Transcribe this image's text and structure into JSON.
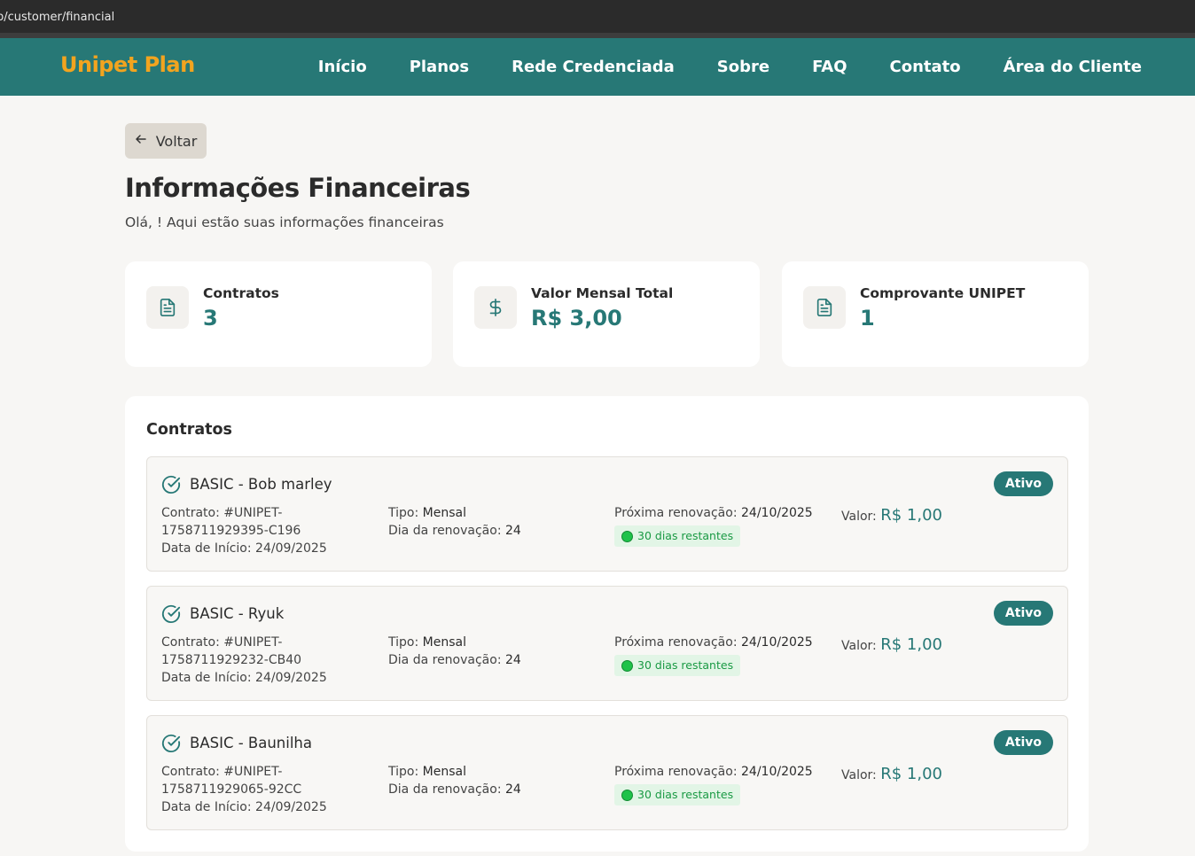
{
  "browser": {
    "url": "p/customer/financial"
  },
  "nav": {
    "logo": "Unipet Plan",
    "links": [
      "Início",
      "Planos",
      "Rede Credenciada",
      "Sobre",
      "FAQ",
      "Contato",
      "Área do Cliente"
    ]
  },
  "back_label": "Voltar",
  "page": {
    "title": "Informações Financeiras",
    "subtitle": "Olá, ! Aqui estão suas informações financeiras"
  },
  "stats": [
    {
      "label": "Contratos",
      "value": "3",
      "icon": "document-icon"
    },
    {
      "label": "Valor Mensal Total",
      "value": "R$ 3,00",
      "icon": "dollar-icon"
    },
    {
      "label": "Comprovante UNIPET",
      "value": "1",
      "icon": "document-icon"
    }
  ],
  "contracts_title": "Contratos",
  "labels": {
    "contract": "Contrato:",
    "start": "Data de Início:",
    "type": "Tipo:",
    "renewal_day": "Dia da renovação:",
    "next_renewal": "Próxima renovação:",
    "value": "Valor:"
  },
  "contracts": [
    {
      "title": "BASIC - Bob marley",
      "status": "Ativo",
      "number": "#UNIPET-1758711929395-C196",
      "start_date": "24/09/2025",
      "type": "Mensal",
      "renewal_day": "24",
      "next_renewal": "24/10/2025",
      "days_left": "30 dias restantes",
      "value": "R$ 1,00"
    },
    {
      "title": "BASIC - Ryuk",
      "status": "Ativo",
      "number": "#UNIPET-1758711929232-CB40",
      "start_date": "24/09/2025",
      "type": "Mensal",
      "renewal_day": "24",
      "next_renewal": "24/10/2025",
      "days_left": "30 dias restantes",
      "value": "R$ 1,00"
    },
    {
      "title": "BASIC - Baunilha",
      "status": "Ativo",
      "number": "#UNIPET-1758711929065-92CC",
      "start_date": "24/09/2025",
      "type": "Mensal",
      "renewal_day": "24",
      "next_renewal": "24/10/2025",
      "days_left": "30 dias restantes",
      "value": "R$ 1,00"
    }
  ],
  "colors": {
    "brand": "#277876",
    "logo": "#f2a41f",
    "badge_green": "#1fc24a"
  }
}
